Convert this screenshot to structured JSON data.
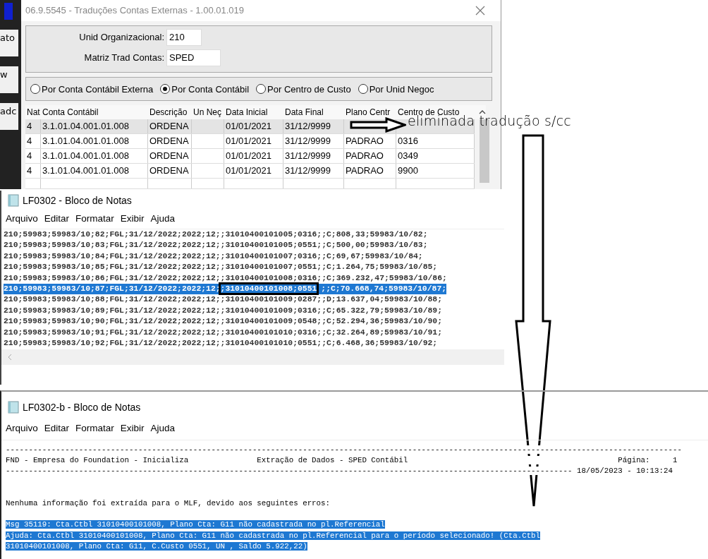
{
  "background_app": {
    "fragments": [
      "ato",
      "w",
      "adc"
    ]
  },
  "dialog": {
    "title": "06.9.5545 - Traduções Contas Externas - 1.00.01.019",
    "form": [
      {
        "label": "Unid Organizacional:",
        "value": "210"
      },
      {
        "label": "Matriz Trad Contas:",
        "value": "SPED"
      }
    ],
    "radios": [
      {
        "label": "Por Conta Contábil Externa",
        "selected": false
      },
      {
        "label": "Por Conta Contábil",
        "selected": true
      },
      {
        "label": "Por Centro de Custo",
        "selected": false
      },
      {
        "label": "Por Unid Negoc",
        "selected": false
      }
    ],
    "grid": {
      "columns": [
        "Nat",
        "Conta Contábil",
        "Descrição",
        "Un Neç",
        "Data Inicial",
        "Data Final",
        "Plano Centr",
        "Centro de Custo"
      ],
      "rows": [
        {
          "selected": true,
          "cells": [
            "4",
            "3.1.01.04.001.01.008",
            "ORDENA",
            null,
            "01/01/2021",
            "31/12/9999",
            null,
            null
          ]
        },
        {
          "selected": false,
          "cells": [
            "4",
            "3.1.01.04.001.01.008",
            "ORDENA",
            null,
            "01/01/2021",
            "31/12/9999",
            "PADRAO",
            "0316"
          ]
        },
        {
          "selected": false,
          "cells": [
            "4",
            "3.1.01.04.001.01.008",
            "ORDENA",
            null,
            "01/01/2021",
            "31/12/9999",
            "PADRAO",
            "0349"
          ]
        },
        {
          "selected": false,
          "cells": [
            "4",
            "3.1.01.04.001.01.008",
            "ORDENA",
            null,
            "01/01/2021",
            "31/12/9999",
            "PADRAO",
            "9900"
          ]
        }
      ]
    }
  },
  "notepad_1": {
    "title": "LF0302 - Bloco de Notas",
    "menu": [
      "Arquivo",
      "Editar",
      "Formatar",
      "Exibir",
      "Ajuda"
    ],
    "lines": [
      {
        "selected": false,
        "segments": [
          {
            "text": "210;59983;59983/10;82;FGL;31/12/2022;2022;12;;31010400101005;0316;;C;808,33;59983/10/82;",
            "boxed": false
          }
        ]
      },
      {
        "selected": false,
        "segments": [
          {
            "text": "210;59983;59983/10;83;FGL;31/12/2022;2022;12;;31010400101005;0551;;C;500,00;59983/10/83;",
            "boxed": false
          }
        ]
      },
      {
        "selected": false,
        "segments": [
          {
            "text": "210;59983;59983/10;84;FGL;31/12/2022;2022;12;;31010400101007;0316;;C;69,67;59983/10/84;",
            "boxed": false
          }
        ]
      },
      {
        "selected": false,
        "segments": [
          {
            "text": "210;59983;59983/10;85;FGL;31/12/2022;2022;12;;31010400101007;0551;;C;1.264,75;59983/10/85;",
            "boxed": false
          }
        ]
      },
      {
        "selected": false,
        "segments": [
          {
            "text": "210;59983;59983/10;86;FGL;31/12/2022;2022;12;;31010400101008;0316;;C;369.232,47;59983/10/86;",
            "boxed": false
          }
        ]
      },
      {
        "selected": true,
        "segments": [
          {
            "text": "210;59983;59983/10;87;FGL;31/12/2022;2022;12;",
            "boxed": false
          },
          {
            "text": ";31010400101008;0551",
            "boxed": true
          },
          {
            "text": ";;C;70.668,74;59983/10/87;",
            "boxed": false
          }
        ]
      },
      {
        "selected": false,
        "segments": [
          {
            "text": "210;59983;59983/10;88;FGL;31/12/2022;2022;12;;31010400101009;0287;;D;13.637,04;59983/10/88;",
            "boxed": false
          }
        ]
      },
      {
        "selected": false,
        "segments": [
          {
            "text": "210;59983;59983/10;89;FGL;31/12/2022;2022;12;;31010400101009;0316;;C;65.322,79;59983/10/89;",
            "boxed": false
          }
        ]
      },
      {
        "selected": false,
        "segments": [
          {
            "text": "210;59983;59983/10;90;FGL;31/12/2022;2022;12;;31010400101009;0548;;C;52.294,36;59983/10/90;",
            "boxed": false
          }
        ]
      },
      {
        "selected": false,
        "segments": [
          {
            "text": "210;59983;59983/10;91;FGL;31/12/2022;2022;12;;31010400101010;0316;;C;32.264,89;59983/10/91;",
            "boxed": false
          }
        ]
      },
      {
        "selected": false,
        "segments": [
          {
            "text": "210;59983;59983/10;92;FGL;31/12/2022;2022;12;;31010400101010;0551;;C;6.468,36;59983/10/92;",
            "boxed": false
          }
        ]
      }
    ]
  },
  "notepad_2": {
    "title": "LF0302-b - Bloco de Notas",
    "menu": [
      "Arquivo",
      "Editar",
      "Formatar",
      "Exibir",
      "Ajuda"
    ],
    "lines": [
      {
        "kind": "text",
        "selected": false,
        "text": "----------------------------------------------------------------------------------------------------------------------------------------------------"
      },
      {
        "kind": "text",
        "selected": false,
        "text": "FND - Empresa do Foundation - Inicializa               Extração de Dados - SPED Contábil                                              Página:     1"
      },
      {
        "kind": "text",
        "selected": false,
        "text": "---------------------------------------------------------------------------------------------------------------------------- 18/05/2023 - 10:13:24"
      },
      {
        "kind": "blank"
      },
      {
        "kind": "blank"
      },
      {
        "kind": "text",
        "selected": false,
        "text": "Nenhuma informação foi extraída para o MLF, devido aos seguintes erros:"
      },
      {
        "kind": "blank"
      },
      {
        "kind": "text",
        "selected": true,
        "text": "Msg 35119: Cta.Ctbl 31010400101008, Plano Cta: G11 não cadastrada no pl.Referencial"
      },
      {
        "kind": "text",
        "selected": true,
        "text": "Ajuda: Cta.Ctbl 31010400101008, Plano Cta: G11 não cadastrada no pl.Referencial para o período selecionado! (Cta.Ctbl"
      },
      {
        "kind": "text",
        "selected": true,
        "text": "31010400101008, Plano Cta: G11, C.Custo 0551, UN , Saldo 5.922,22)"
      }
    ]
  },
  "annotation": {
    "note": "eliminada tradução s/cc"
  }
}
